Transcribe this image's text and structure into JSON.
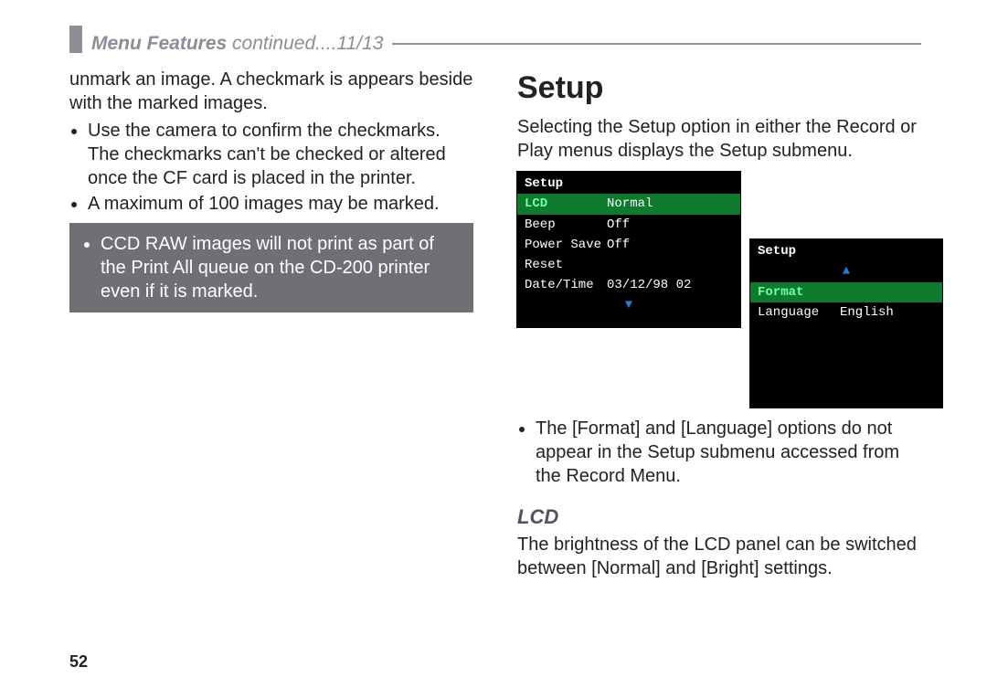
{
  "header": {
    "section": "Menu Features",
    "suffix": "continued....11/13"
  },
  "left": {
    "intro": "unmark an image. A checkmark is appears beside with the marked images.",
    "bullets": [
      "Use the camera to confirm the checkmarks. The checkmarks can't be checked or altered once the CF card is placed in the printer.",
      "A maximum of 100 images may be marked."
    ],
    "note": "CCD RAW images will not print as part of the Print All queue on the CD-200 printer even if it is marked."
  },
  "right": {
    "title": "Setup",
    "intro": "Selecting the Setup option in either the Record or Play menus displays the Setup submenu.",
    "lcd1": {
      "title": "Setup",
      "rows": [
        {
          "label": "LCD",
          "value": "Normal",
          "hl": true
        },
        {
          "label": "Beep",
          "value": "Off"
        },
        {
          "label": "Power Save",
          "value": "Off"
        },
        {
          "label": "Reset",
          "value": ""
        },
        {
          "label": "Date/Time",
          "value": "03/12/98 02"
        }
      ]
    },
    "lcd2": {
      "title": "Setup",
      "rows": [
        {
          "label": "Format",
          "value": "",
          "hl": true
        },
        {
          "label": "Language",
          "value": "English"
        }
      ]
    },
    "bullet": "The [Format] and [Language] options do not appear in the Setup submenu accessed from the Record Menu.",
    "lcd_heading": "LCD",
    "lcd_text": "The brightness of the LCD panel can be switched between [Normal] and [Bright] settings."
  },
  "page_number": "52"
}
